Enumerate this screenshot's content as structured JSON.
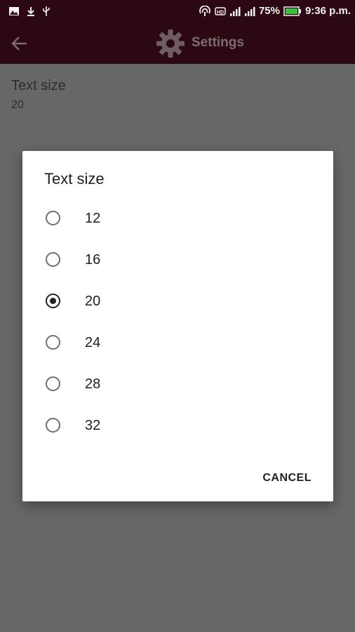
{
  "status_bar": {
    "battery": "75%",
    "time": "9:36 p.m.",
    "icons": [
      "image-icon",
      "download-icon",
      "usb-icon",
      "hotspot-icon",
      "hd-icon",
      "signal-icon",
      "signal-icon",
      "battery-icon"
    ]
  },
  "app_bar": {
    "title": "Settings",
    "back_icon": "arrow-left-icon",
    "gear_icon": "gear-icon"
  },
  "preference": {
    "title": "Text size",
    "value": "20"
  },
  "dialog": {
    "title": "Text size",
    "options": [
      {
        "label": "12",
        "selected": false
      },
      {
        "label": "16",
        "selected": false
      },
      {
        "label": "20",
        "selected": true
      },
      {
        "label": "24",
        "selected": false
      },
      {
        "label": "28",
        "selected": false
      },
      {
        "label": "32",
        "selected": false
      }
    ],
    "cancel_label": "CANCEL"
  },
  "colors": {
    "status_bar_bg": "#2b0812",
    "scrim": "#676767",
    "dialog_bg": "#ffffff",
    "battery_fill": "#3cc03c"
  }
}
